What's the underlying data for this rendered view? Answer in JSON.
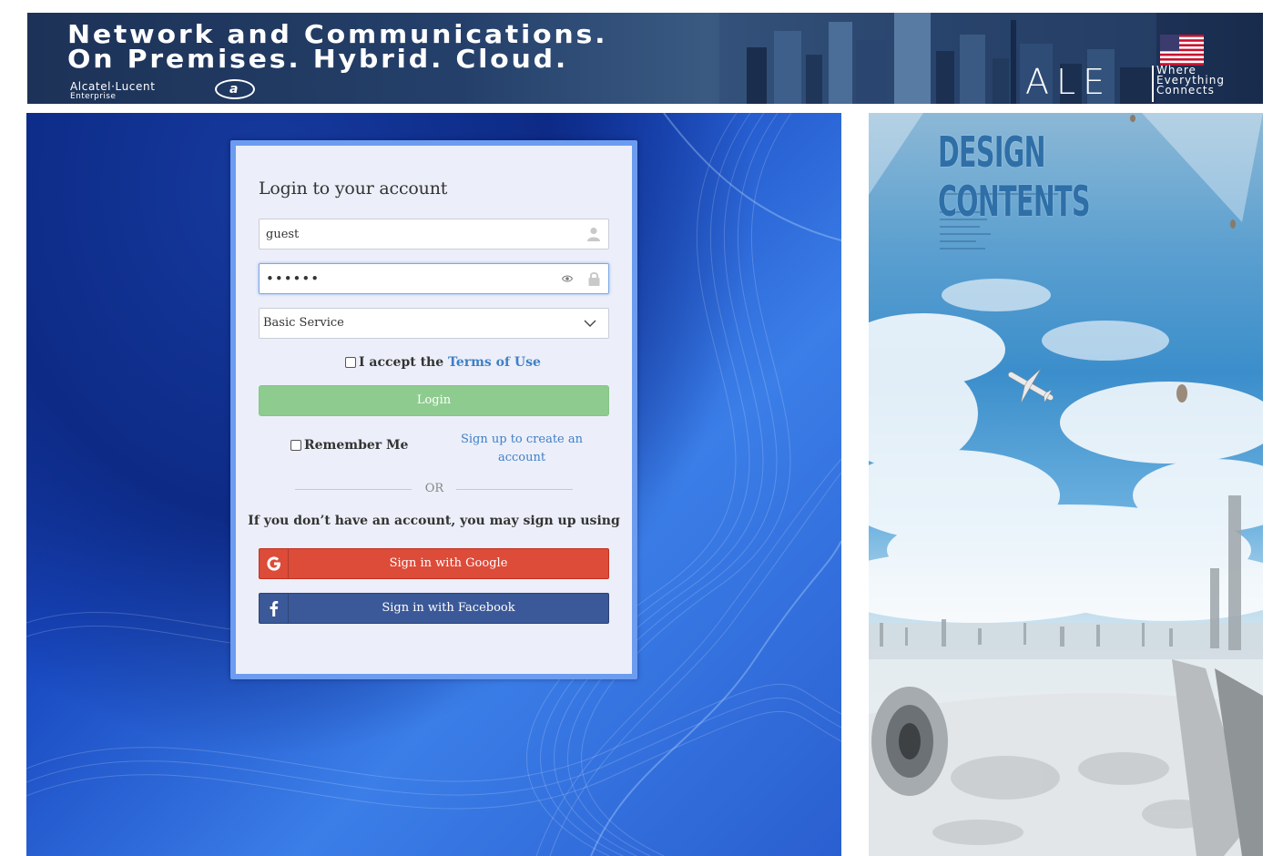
{
  "banner": {
    "headline_line1": "Network and Communications.",
    "headline_line2": "On Premises. Hybrid. Cloud.",
    "brand_name": "Alcatel·Lucent",
    "brand_sub": "Enterprise",
    "ale_logo": "ALE",
    "ale_tagline_1": "Where",
    "ale_tagline_2": "Everything",
    "ale_tagline_3": "Connects",
    "flag_icon": "us-flag-icon"
  },
  "login": {
    "title": "Login to your account",
    "username_value": "guest",
    "password_value": "••••••",
    "service_value": "Basic Service",
    "terms_prefix": "I accept the",
    "terms_link": "Terms of Use",
    "login_button": "Login",
    "remember_me": "Remember Me",
    "signup_link": "Sign up to create an account",
    "or_text": "OR",
    "signup_hint": "If you don’t have an account, you may sign up using",
    "google_button": "Sign in with Google",
    "facebook_button": "Sign in with Facebook"
  },
  "promo": {
    "title": "DESIGN CONTENTS"
  },
  "colors": {
    "login_button_bg": "#8dcc8e",
    "google_bg": "#dd4b39",
    "facebook_bg": "#3b5998",
    "link": "#3f7fc7",
    "card_border": "#6c9cf0"
  }
}
